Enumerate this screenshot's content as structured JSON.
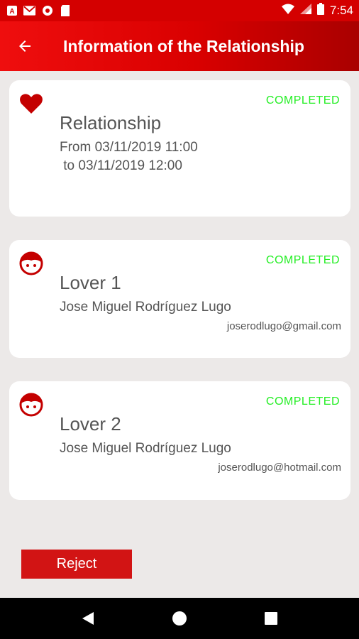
{
  "status_bar": {
    "time": "7:54"
  },
  "header": {
    "title": "Information of the Relationship",
    "back_icon": "arrow-left-icon"
  },
  "cards": [
    {
      "icon": "heart-icon",
      "status": "COMPLETED",
      "title": "Relationship",
      "line1": "From 03/11/2019 11:00",
      "line2": " to 03/11/2019 12:00"
    },
    {
      "icon": "face-icon",
      "status": "COMPLETED",
      "title": "Lover 1",
      "name": "Jose Miguel Rodríguez Lugo",
      "email": "joserodlugo@gmail.com"
    },
    {
      "icon": "face-icon",
      "status": "COMPLETED",
      "title": "Lover 2",
      "name": "Jose Miguel Rodríguez Lugo",
      "email": "joserodlugo@hotmail.com"
    }
  ],
  "actions": {
    "reject_label": "Reject"
  },
  "colors": {
    "primary": "#d40000",
    "status_completed": "#22ee22",
    "reject": "#d21414",
    "background": "#ece9e8"
  }
}
